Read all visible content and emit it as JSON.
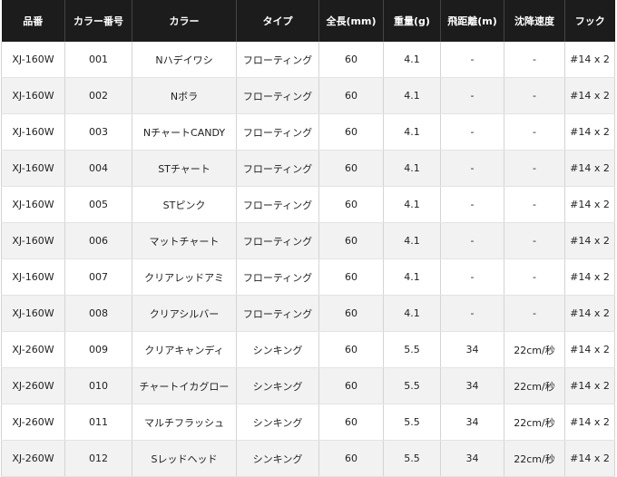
{
  "table": {
    "headers": [
      "品番",
      "カラー番号",
      "カラー",
      "タイプ",
      "全長(mm)",
      "重量(g)",
      "飛距離(m)",
      "沈降速度",
      "フック"
    ],
    "rows": [
      [
        "XJ-160W",
        "001",
        "Nハデイワシ",
        "フローティング",
        "60",
        "4.1",
        "-",
        "-",
        "#14 x 2"
      ],
      [
        "XJ-160W",
        "002",
        "Nボラ",
        "フローティング",
        "60",
        "4.1",
        "-",
        "-",
        "#14 x 2"
      ],
      [
        "XJ-160W",
        "003",
        "NチャートCANDY",
        "フローティング",
        "60",
        "4.1",
        "-",
        "-",
        "#14 x 2"
      ],
      [
        "XJ-160W",
        "004",
        "STチャート",
        "フローティング",
        "60",
        "4.1",
        "-",
        "-",
        "#14 x 2"
      ],
      [
        "XJ-160W",
        "005",
        "STピンク",
        "フローティング",
        "60",
        "4.1",
        "-",
        "-",
        "#14 x 2"
      ],
      [
        "XJ-160W",
        "006",
        "マットチャート",
        "フローティング",
        "60",
        "4.1",
        "-",
        "-",
        "#14 x 2"
      ],
      [
        "XJ-160W",
        "007",
        "クリアレッドアミ",
        "フローティング",
        "60",
        "4.1",
        "-",
        "-",
        "#14 x 2"
      ],
      [
        "XJ-160W",
        "008",
        "クリアシルバー",
        "フローティング",
        "60",
        "4.1",
        "-",
        "-",
        "#14 x 2"
      ],
      [
        "XJ-260W",
        "009",
        "クリアキャンディ",
        "シンキング",
        "60",
        "5.5",
        "34",
        "22cm/秒",
        "#14 x 2"
      ],
      [
        "XJ-260W",
        "010",
        "チャートイカグロー",
        "シンキング",
        "60",
        "5.5",
        "34",
        "22cm/秒",
        "#14 x 2"
      ],
      [
        "XJ-260W",
        "011",
        "マルチフラッシュ",
        "シンキング",
        "60",
        "5.5",
        "34",
        "22cm/秒",
        "#14 x 2"
      ],
      [
        "XJ-260W",
        "012",
        "Sレッドヘッド",
        "シンキング",
        "60",
        "5.5",
        "34",
        "22cm/秒",
        "#14 x 2"
      ]
    ]
  }
}
